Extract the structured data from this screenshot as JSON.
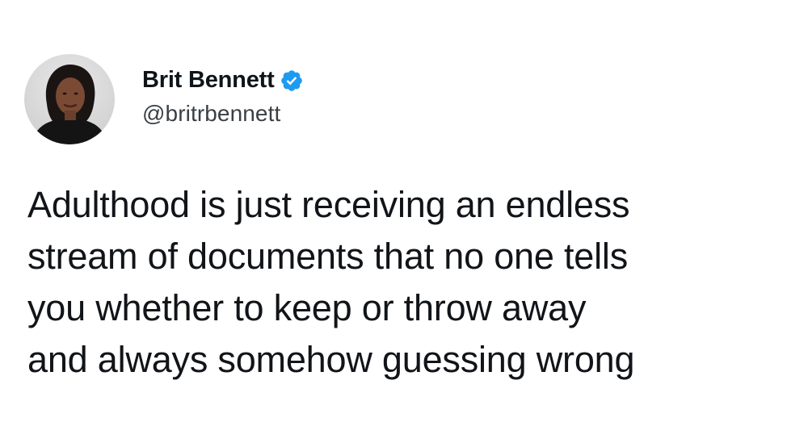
{
  "author": {
    "display_name": "Brit Bennett",
    "handle": "@britrbennett",
    "verified": true,
    "verified_icon": "verified-badge-icon",
    "verified_color": "#1d9bf0"
  },
  "tweet": {
    "lines": [
      "Adulthood is just receiving an endless",
      "stream of documents that no one tells",
      "you whether to keep or throw away",
      "and always somehow guessing wrong"
    ]
  }
}
